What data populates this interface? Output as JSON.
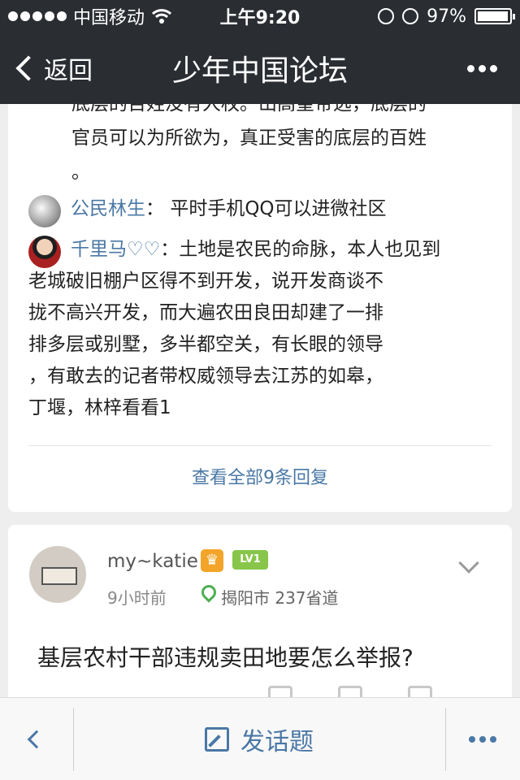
{
  "status_bar": {
    "carrier": "中国移动",
    "time": "上午9:20",
    "battery": "97%"
  },
  "nav": {
    "back_label": "返回",
    "title": "少年中国论坛"
  },
  "comment_card": {
    "partial_lines": [
      "底层的百姓没有人权。山高皇帝远，底层的",
      "官员可以为所欲为，真正受害的底层的百姓",
      "。"
    ],
    "replies": [
      {
        "name": "公民林生",
        "sep": "：",
        "text": "平时手机QQ可以进微社区"
      },
      {
        "name": "千里马♡♡",
        "sep": "：",
        "lines": [
          "土地是农民的命脉，本人也见到",
          "老城破旧棚户区得不到开发，说开发商谈不",
          "拢不高兴开发，而大遍农田良田却建了一排",
          "排多层或别墅，多半都空关，有长眼的领导",
          "，有敢去的记者带权威领导去江苏的如皋，",
          "丁堰，林梓看看1"
        ]
      }
    ],
    "view_all": "查看全部9条回复"
  },
  "post_card": {
    "username": "my~katie",
    "level": "LV1",
    "time_ago": "9小时前",
    "location": "揭阳市 237省道",
    "title": "基层农村干部违规卖田地要怎么举报?"
  },
  "bottom_bar": {
    "post_label": "发话题"
  }
}
